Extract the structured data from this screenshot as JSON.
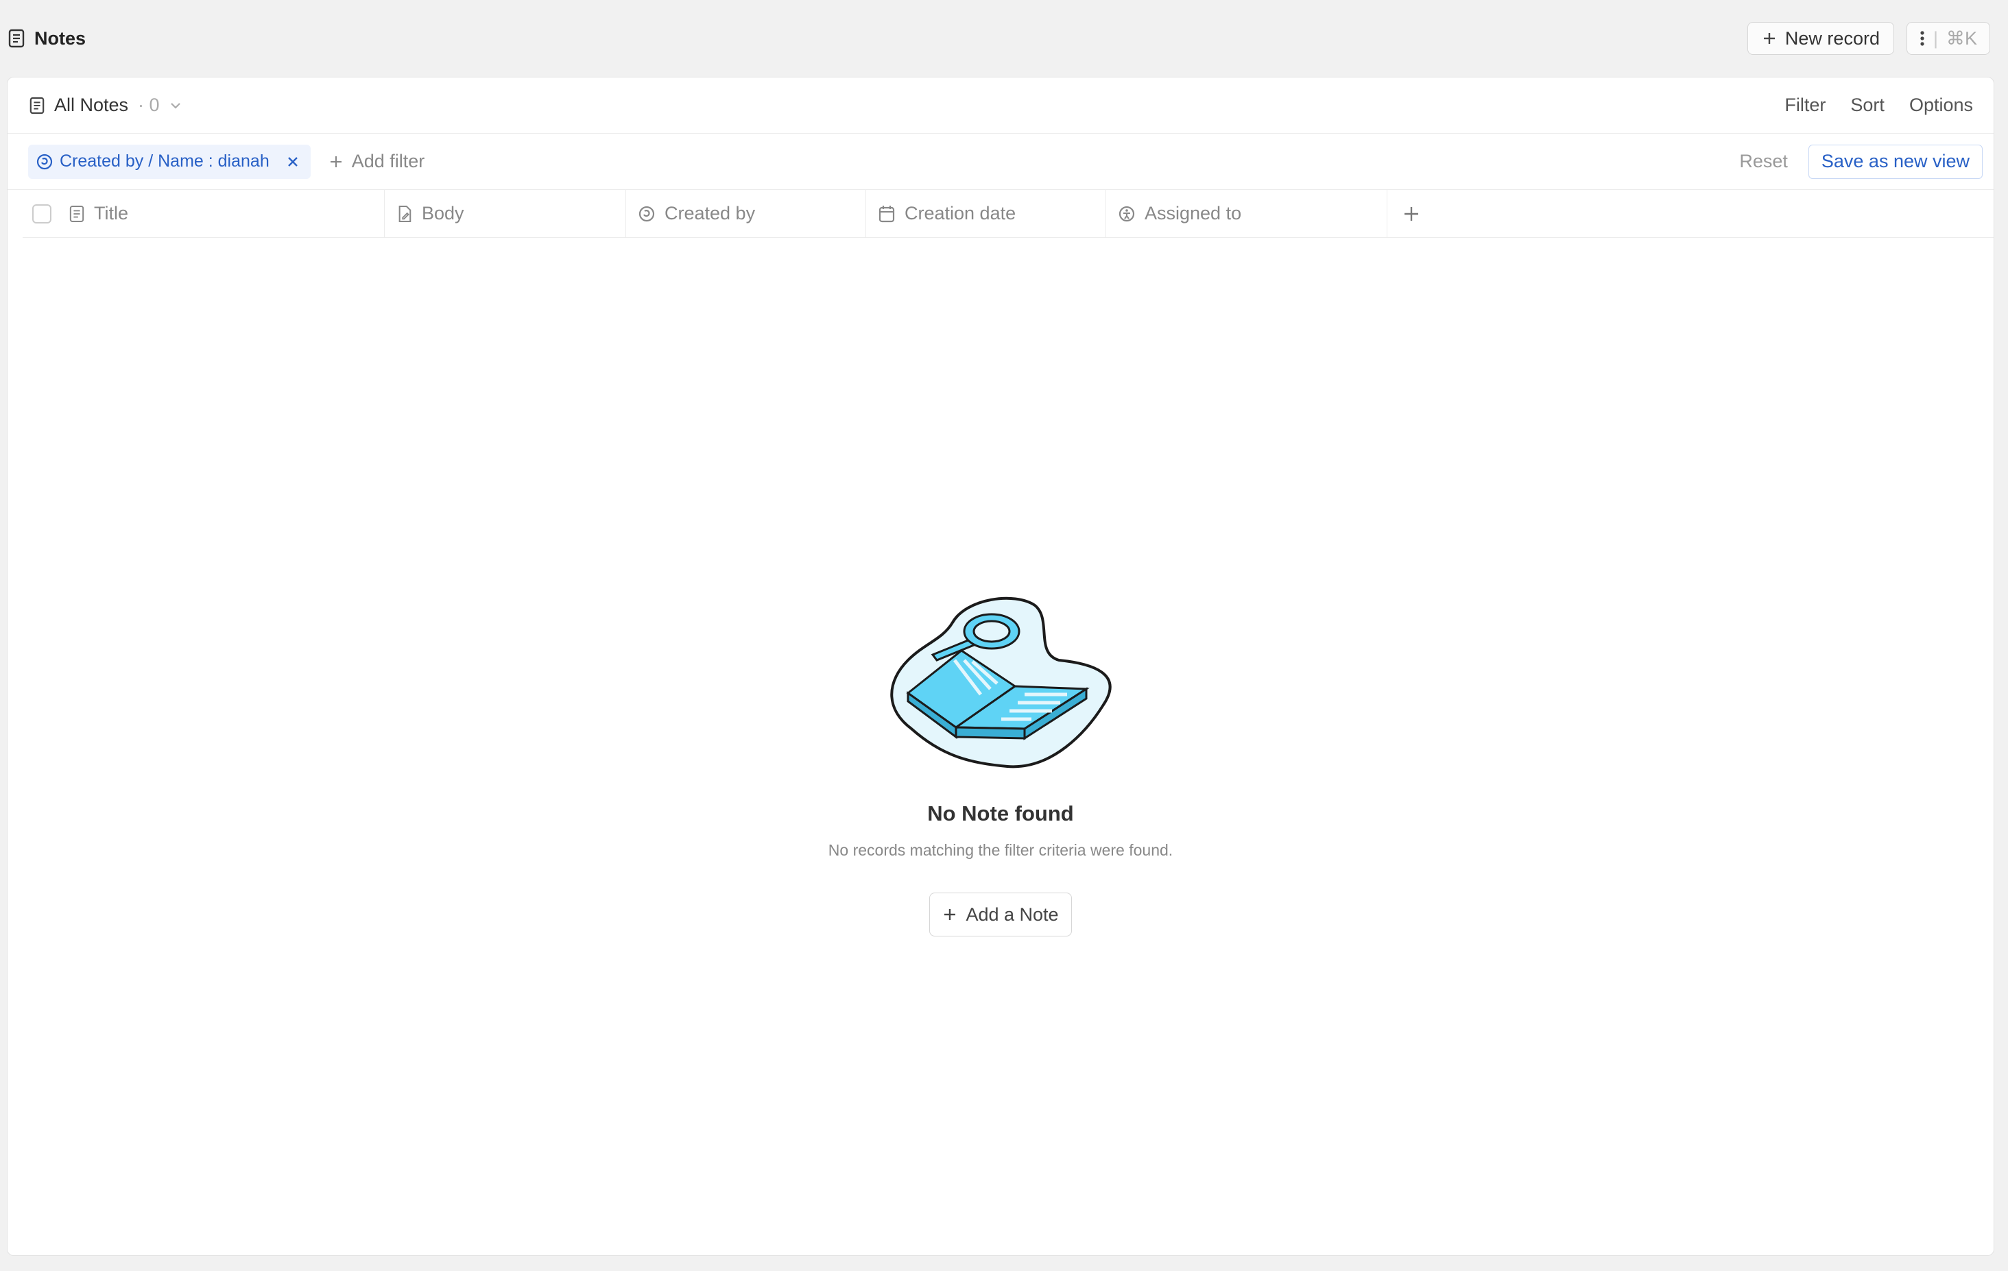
{
  "header": {
    "title": "Notes",
    "new_record_label": "New record",
    "shortcut": "⌘K"
  },
  "view": {
    "name": "All Notes",
    "count": "· 0",
    "actions": {
      "filter": "Filter",
      "sort": "Sort",
      "options": "Options"
    }
  },
  "filters": {
    "chip_label": "Created by / Name : dianah",
    "add_filter_label": "Add filter",
    "reset_label": "Reset",
    "save_view_label": "Save as new view"
  },
  "table": {
    "columns": [
      {
        "label": "Title",
        "icon": "document-icon"
      },
      {
        "label": "Body",
        "icon": "file-edit-icon"
      },
      {
        "label": "Created by",
        "icon": "actor-icon"
      },
      {
        "label": "Creation date",
        "icon": "calendar-icon"
      },
      {
        "label": "Assigned to",
        "icon": "person-circle-icon"
      }
    ]
  },
  "empty_state": {
    "heading": "No Note found",
    "subtext": "No records matching the filter criteria were found.",
    "button_label": "Add a Note"
  },
  "colors": {
    "accent": "#2860c6",
    "illustration_fill": "#5fd3f5",
    "illustration_bg": "#e4f6fc"
  }
}
